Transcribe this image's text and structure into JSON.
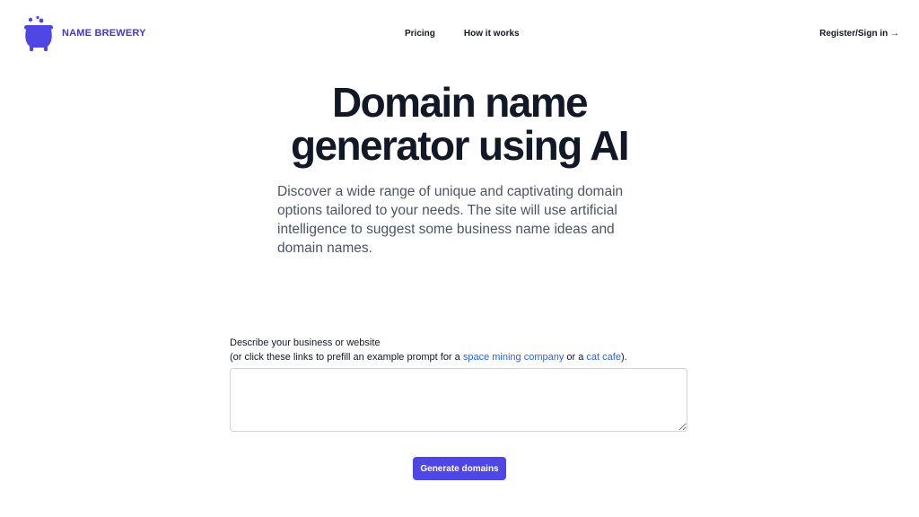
{
  "header": {
    "brand": "NAME BREWERY",
    "logo_icon": "cauldron-icon",
    "nav": [
      {
        "label": "Pricing"
      },
      {
        "label": "How it works"
      }
    ],
    "signin_label": "Register/Sign in →"
  },
  "hero": {
    "title_line1": "Domain name",
    "title_line2": "generator using AI",
    "description": "Discover a wide range of unique and captivating domain options tailored to your needs. The site will use artificial intelligence to suggest some business name ideas and domain names."
  },
  "form": {
    "label": "Describe your business or website",
    "hint_prefix": "(or click these links to prefill an example prompt for a ",
    "example1": "space mining company",
    "hint_middle": " or a ",
    "example2": "cat cafe",
    "hint_suffix": ").",
    "prompt_value": "",
    "button_label": "Generate domains"
  },
  "colors": {
    "brand": "#4338ca",
    "button": "#4f46e5",
    "link": "#2563eb",
    "heading": "#111827",
    "body_text": "#4b5563"
  }
}
